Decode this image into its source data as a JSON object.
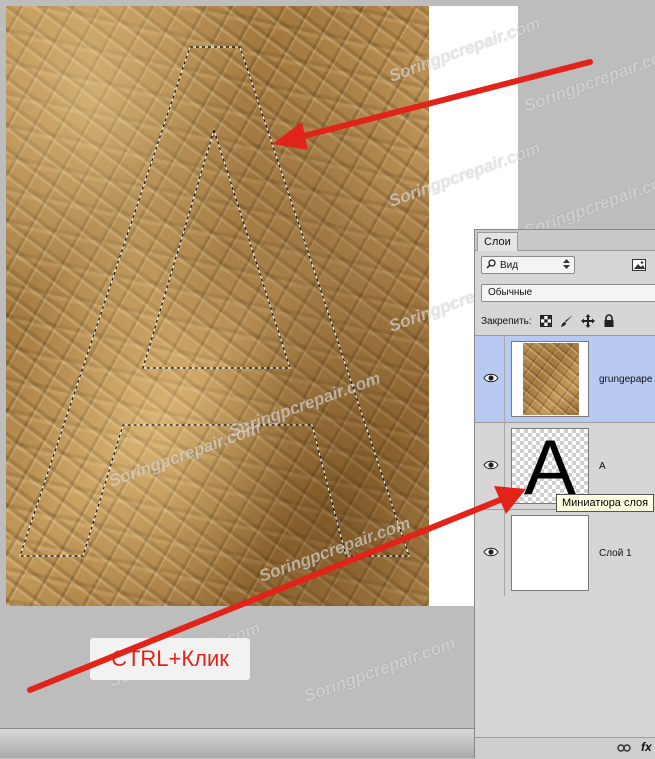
{
  "watermark_text": "Soringpcrepair.com",
  "annotation": {
    "ctrl_click_label": "CTRL+Клик"
  },
  "colors": {
    "arrow": "#e2231a",
    "selected_layer": "#b8c9f2"
  },
  "layers_panel": {
    "tab_label": "Слои",
    "filter": {
      "icon": "search-icon",
      "value": "Вид"
    },
    "image_filter_icon": "image-icon",
    "blend_mode": "Обычные",
    "lock_label": "Закрепить:",
    "lock_icons": [
      "lock-transparent-icon",
      "brush-icon",
      "move-icon",
      "lock-icon"
    ],
    "layers": [
      {
        "name": "grungepape",
        "thumbnail": "grunge-paper",
        "selected": true,
        "visible": true
      },
      {
        "name": "A",
        "thumbnail": "letter-A",
        "glyph": "A",
        "selected": false,
        "visible": true
      },
      {
        "name": "Слой 1",
        "thumbnail": "white",
        "selected": false,
        "visible": true
      }
    ],
    "tooltip": "Миниатюра слоя",
    "footer_icons": [
      "link-icon",
      "fx-icon"
    ],
    "footer_fx_label": "fx"
  }
}
